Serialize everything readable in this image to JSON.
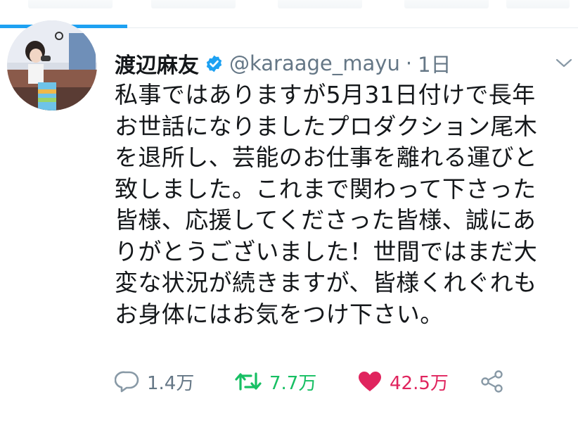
{
  "tweet": {
    "display_name": "渡辺麻友",
    "handle": "@karaage_mayu",
    "separator": "·",
    "time": "1日",
    "text_lines": [
      "私事ではありますが5月31日付けで長年",
      "お世話になりましたプロダクション尾木",
      "を退所し、芸能のお仕事を離れる運びと",
      "致しました。これまで関わって下さった",
      "皆様、応援してくださった皆様、誠にあ",
      "りがとうございました！世間ではまだ大",
      "変な状況が続きますが、皆様くれぐれも",
      "お身体にはお気をつけ下さい。"
    ]
  },
  "actions": {
    "reply_count": "1.4万",
    "retweet_count": "7.7万",
    "like_count": "42.5万"
  },
  "icons": {
    "verified": "verified-badge-icon",
    "more": "chevron-down-icon",
    "reply": "reply-bubble-icon",
    "retweet": "retweet-icon",
    "like": "heart-icon",
    "share": "share-icon"
  },
  "colors": {
    "accent": "#1da1f2",
    "retweet": "#17bf63",
    "like": "#e0245e",
    "secondary_text": "#657786"
  }
}
